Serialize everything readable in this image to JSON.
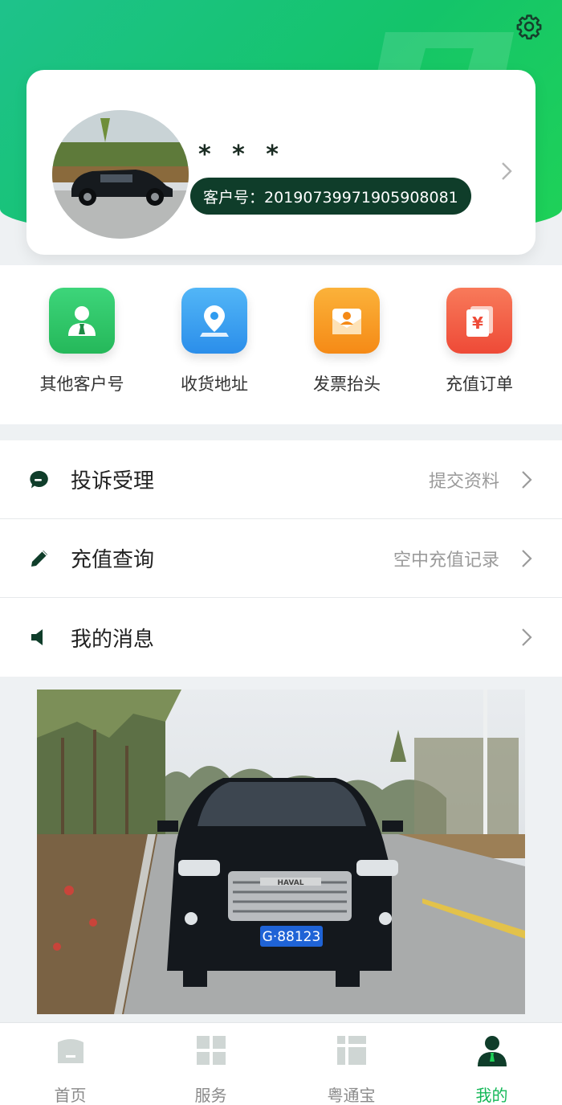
{
  "header": {
    "settings_icon": "gear-icon",
    "accent_color": "#14c46a"
  },
  "profile": {
    "name": "* * *",
    "customer_id": "客户号：20190739971905908081",
    "avatar": "car-photo-avatar"
  },
  "shortcuts": [
    {
      "label": "其他客户号",
      "icon": "person-tie-icon",
      "color": "#2ec866"
    },
    {
      "label": "收货地址",
      "icon": "map-pin-icon",
      "color": "#2f9cf0"
    },
    {
      "label": "发票抬头",
      "icon": "envelope-person-icon",
      "color": "#f79a1e"
    },
    {
      "label": "充值订单",
      "icon": "yen-document-icon",
      "color": "#f0543f"
    }
  ],
  "menu": [
    {
      "title": "投诉受理",
      "hint": "提交资料",
      "icon": "chat-bubble-icon"
    },
    {
      "title": "充值查询",
      "hint": "空中充值记录",
      "icon": "pencil-icon"
    },
    {
      "title": "我的消息",
      "hint": "",
      "icon": "speaker-icon"
    }
  ],
  "banner": {
    "plate": "G·88123",
    "grille_text": "HAVAL"
  },
  "tabs": [
    {
      "label": "首页",
      "icon": "home-icon"
    },
    {
      "label": "服务",
      "icon": "grid-icon"
    },
    {
      "label": "粤通宝",
      "icon": "dashboard-icon"
    },
    {
      "label": "我的",
      "icon": "user-icon",
      "active": true
    }
  ]
}
